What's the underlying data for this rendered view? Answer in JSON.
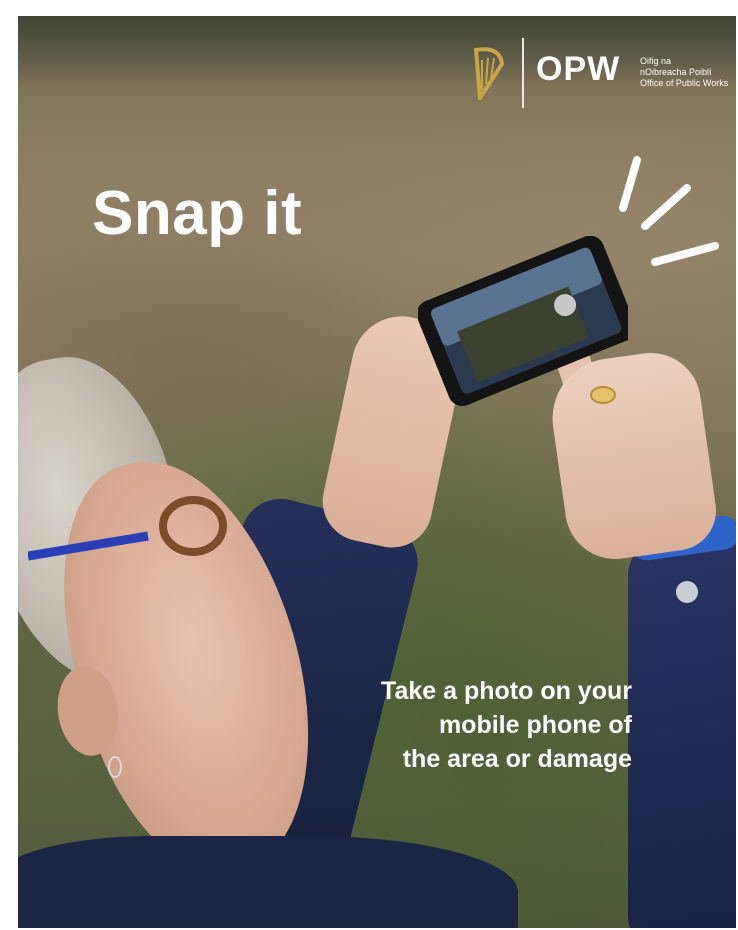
{
  "logo": {
    "wordmark": "OPW",
    "subtitle_line1": "Oifig na",
    "subtitle_line2": "nOibreacha Poiblí",
    "subtitle_line3": "Office of Public Works",
    "icon": "harp-icon",
    "color": "#c9a54a"
  },
  "headline": "Snap it",
  "caption": {
    "line1": "Take a photo on your",
    "line2": "mobile phone of",
    "line3": "the area or damage"
  },
  "colors": {
    "text": "#ffffff",
    "jacket": "#1c2544",
    "cuff": "#2e63c7"
  }
}
